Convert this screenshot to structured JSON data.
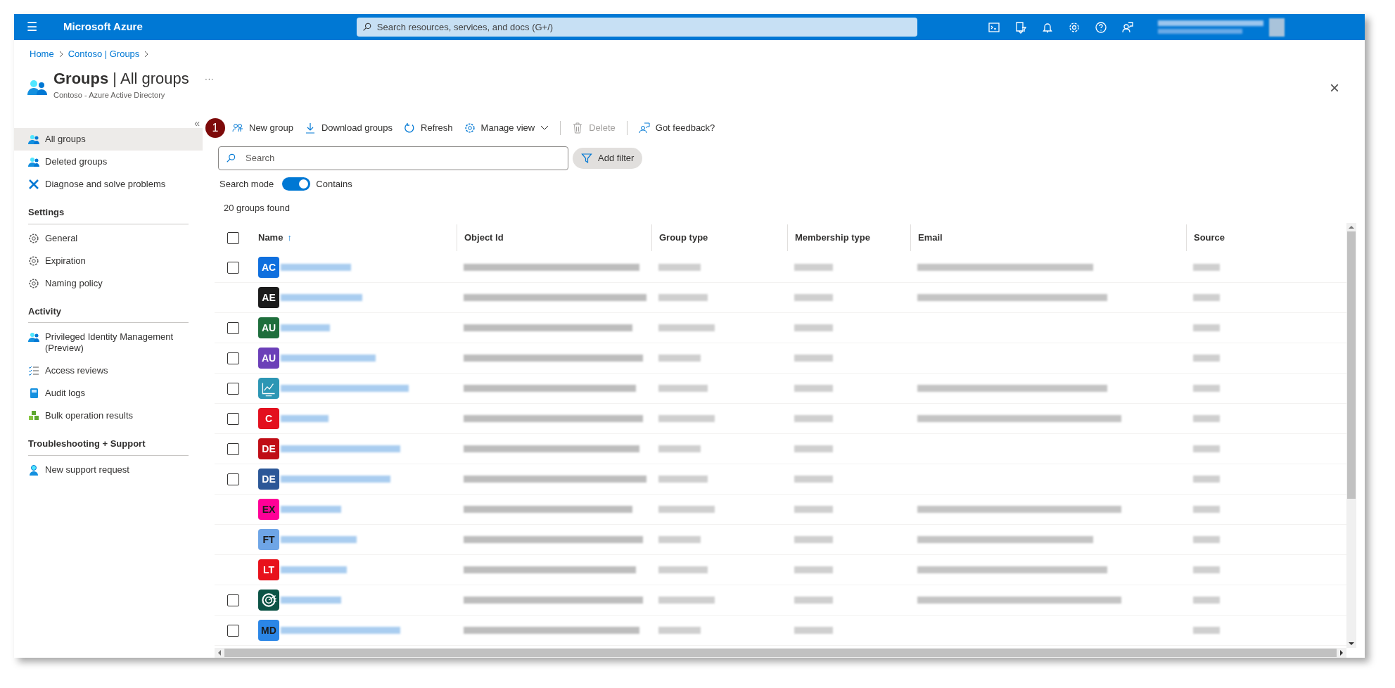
{
  "top_bar": {
    "menu_glyph": "☰",
    "brand": "Microsoft Azure",
    "search": {
      "placeholder": "Search resources, services, and docs (G+/)"
    }
  },
  "breadcrumb": [
    "Home",
    "Contoso | Groups"
  ],
  "page": {
    "title": "Groups",
    "separator": "|",
    "subtitle_part": "All groups",
    "org": "Contoso - Azure Active Directory",
    "more": "···",
    "close": "×"
  },
  "sidebar": {
    "collapse": "«",
    "items": [
      {
        "kind": "item",
        "label": "All groups",
        "selected": true
      },
      {
        "kind": "item",
        "label": "Deleted groups",
        "selected": false
      },
      {
        "kind": "item",
        "label": "Diagnose and solve problems",
        "selected": false
      },
      {
        "kind": "heading",
        "label": "Settings"
      },
      {
        "kind": "item",
        "label": "General",
        "selected": false
      },
      {
        "kind": "item",
        "label": "Expiration",
        "selected": false
      },
      {
        "kind": "item",
        "label": "Naming policy",
        "selected": false
      },
      {
        "kind": "heading",
        "label": "Activity"
      },
      {
        "kind": "item",
        "label": "Privileged Identity Management (Preview)",
        "selected": false
      },
      {
        "kind": "item",
        "label": "Access reviews",
        "selected": false
      },
      {
        "kind": "item",
        "label": "Audit logs",
        "selected": false
      },
      {
        "kind": "item",
        "label": "Bulk operation results",
        "selected": false
      },
      {
        "kind": "heading",
        "label": "Troubleshooting + Support"
      },
      {
        "kind": "item",
        "label": "New support request",
        "selected": false
      }
    ]
  },
  "step_badge": "1",
  "toolbar": [
    {
      "label": "New group",
      "disabled": false,
      "dropdown": false,
      "separator_before": false
    },
    {
      "label": "Download groups",
      "disabled": false,
      "dropdown": false,
      "separator_before": false
    },
    {
      "label": "Refresh",
      "disabled": false,
      "dropdown": false,
      "separator_before": false
    },
    {
      "label": "Manage view",
      "disabled": false,
      "dropdown": true,
      "separator_before": false
    },
    {
      "label": "Delete",
      "disabled": true,
      "dropdown": false,
      "separator_before": true
    },
    {
      "label": "Got feedback?",
      "disabled": false,
      "dropdown": false,
      "separator_before": true
    }
  ],
  "search": {
    "placeholder": "Search"
  },
  "add_filter": "Add filter",
  "search_mode": {
    "label": "Search mode",
    "on": true,
    "value": "Contains"
  },
  "result_count": "20 groups found",
  "table": {
    "columns": [
      {
        "label": "Name",
        "sort": "↑"
      },
      {
        "label": "Object Id"
      },
      {
        "label": "Group type"
      },
      {
        "label": "Membership type"
      },
      {
        "label": "Email"
      },
      {
        "label": "Source"
      }
    ],
    "select_all": {
      "checked": false
    },
    "rows": [
      {
        "checkbox": {
          "checked": false
        },
        "avatar": {
          "kind": "initials",
          "text": "AC",
          "color": "#0f6fde"
        },
        "email": true
      },
      {
        "avatar": {
          "kind": "initials",
          "text": "AE",
          "color": "#1b1b1b"
        },
        "email": true
      },
      {
        "checkbox": {
          "checked": false
        },
        "avatar": {
          "kind": "initials",
          "text": "AU",
          "color": "#1e6e3c"
        },
        "email": false
      },
      {
        "checkbox": {
          "checked": false
        },
        "avatar": {
          "kind": "initials",
          "text": "AU",
          "color": "#6b3fb8"
        },
        "email": false
      },
      {
        "checkbox": {
          "checked": false
        },
        "avatar": {
          "kind": "chart",
          "color": "#2c96b4"
        },
        "email": true
      },
      {
        "checkbox": {
          "checked": false
        },
        "avatar": {
          "kind": "initials",
          "text": "C",
          "color": "#e3101e"
        },
        "email": true
      },
      {
        "checkbox": {
          "checked": false
        },
        "avatar": {
          "kind": "initials",
          "text": "DE",
          "color": "#c00d16"
        },
        "email": false
      },
      {
        "checkbox": {
          "checked": false
        },
        "avatar": {
          "kind": "initials",
          "text": "DE",
          "color": "#2b5797"
        },
        "email": false
      },
      {
        "avatar": {
          "kind": "initials",
          "text": "EX",
          "color": "#ff0097"
        },
        "email": true
      },
      {
        "avatar": {
          "kind": "initials",
          "text": "FT",
          "color": "#6ea5e6"
        },
        "email": true
      },
      {
        "avatar": {
          "kind": "initials",
          "text": "LT",
          "color": "#e8111b"
        },
        "email": true
      },
      {
        "checkbox": {
          "checked": false
        },
        "avatar": {
          "kind": "target",
          "color": "#0b5345"
        },
        "email": true
      },
      {
        "checkbox": {
          "checked": false
        },
        "avatar": {
          "kind": "initials",
          "text": "MD",
          "color": "#2b86e6"
        },
        "email": false
      }
    ]
  }
}
